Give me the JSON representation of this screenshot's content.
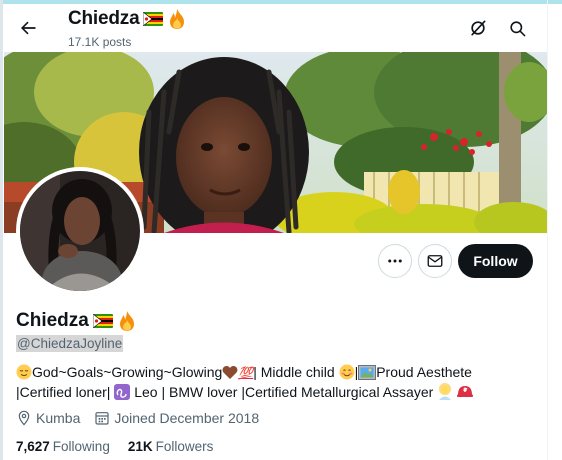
{
  "header": {
    "name": "Chiedza",
    "post_count": "17.1K posts",
    "back_icon": "arrow-left-icon",
    "grok_icon": "grok-icon",
    "search_icon": "search-icon"
  },
  "profile": {
    "name": "Chiedza",
    "handle": "@ChiedzaJoyline",
    "bio_parts": {
      "p1": "God~Goals~Growing~Glowing",
      "p2": "| Middle child",
      "p3": "Proud Aesthete",
      "p4": "|Certified loner|",
      "p5": "Leo | BMW lover |Certified Metallurgical Assayer"
    },
    "location": "Kumba",
    "joined": "Joined December 2018",
    "following_count": "7,627",
    "following_label": "Following",
    "followers_count": "21K",
    "followers_label": "Followers"
  },
  "actions": {
    "follow_label": "Follow",
    "more_icon": "more-icon",
    "message_icon": "envelope-icon"
  },
  "colors": {
    "text": "#0f1419",
    "secondary": "#536471",
    "follow_bg": "#0f1419",
    "border": "#cfd9de"
  }
}
